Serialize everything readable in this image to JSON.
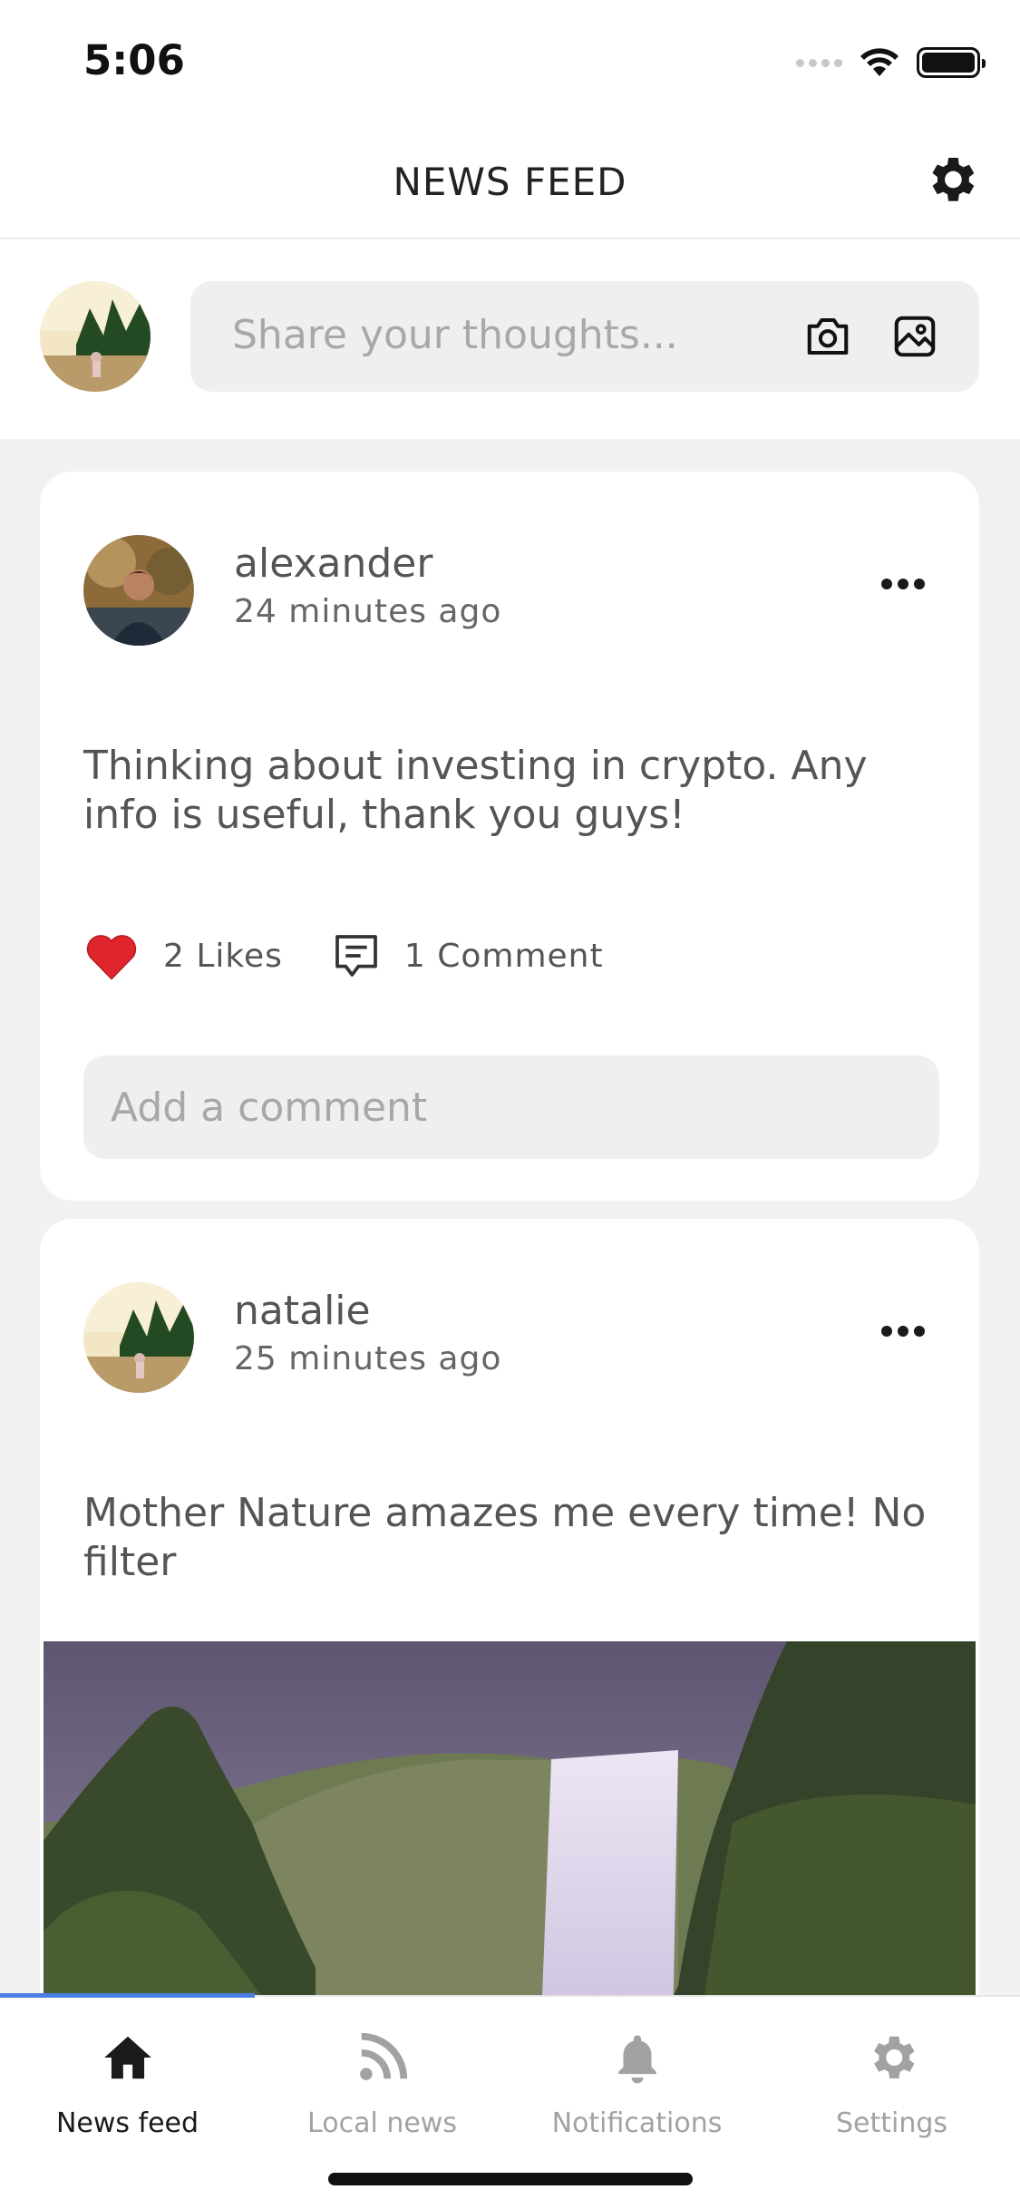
{
  "status_bar": {
    "time": "5:06"
  },
  "header": {
    "title": "NEWS FEED",
    "settings_icon": "gear-icon"
  },
  "composer": {
    "placeholder": "Share your thoughts...",
    "camera_icon": "camera-icon",
    "image_icon": "image-icon"
  },
  "posts": [
    {
      "user": "alexander",
      "time": "24 minutes ago",
      "text": "Thinking about investing in crypto. Any info is useful, thank you guys!",
      "likes": "2 Likes",
      "comments": "1 Comment",
      "comment_placeholder": "Add a comment"
    },
    {
      "user": "natalie",
      "time": "25 minutes ago",
      "text": "Mother Nature amazes me every time! No filter"
    }
  ],
  "nav": {
    "items": [
      {
        "label": "News feed",
        "icon": "home-icon",
        "active": true
      },
      {
        "label": "Local news",
        "icon": "rss-icon",
        "active": false
      },
      {
        "label": "Notifications",
        "icon": "bell-icon",
        "active": false
      },
      {
        "label": "Settings",
        "icon": "gear-icon",
        "active": false
      }
    ]
  },
  "colors": {
    "accent": "#4a7ee0",
    "heart": "#e0262d",
    "card": "#ffffff",
    "background": "#f1f1f1"
  }
}
